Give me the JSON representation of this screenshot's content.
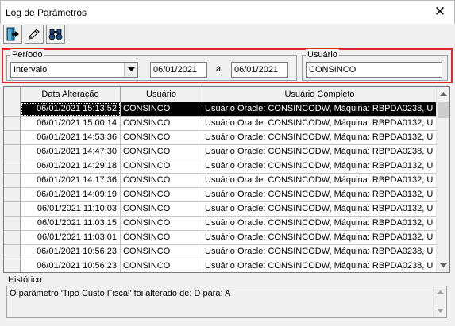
{
  "window": {
    "title": "Log de Parâmetros",
    "close_label": "✕"
  },
  "toolbar": {
    "buttons": [
      {
        "name": "exit-button",
        "icon": "exit-door-icon"
      },
      {
        "name": "edit-button",
        "icon": "pencil-icon"
      },
      {
        "name": "search-button",
        "icon": "binoculars-icon"
      }
    ]
  },
  "filters": {
    "periodo_label": "Período",
    "periodo_value": "Intervalo",
    "date_from": "06/01/2021",
    "separator": "à",
    "date_to": "06/01/2021",
    "usuario_label": "Usuário",
    "usuario_value": "CONSINCO",
    "highlight_color": "#e0252b"
  },
  "grid": {
    "columns": [
      "Data Alteração",
      "Usuário",
      "Usuário Completo"
    ],
    "rows": [
      {
        "date": "06/01/2021 15:13:52",
        "user": "CONSINCO",
        "full": "Usuário Oracle: CONSINCODW, Máquina: RBPDA0238, U",
        "selected": true
      },
      {
        "date": "06/01/2021 15:00:14",
        "user": "CONSINCO",
        "full": "Usuário Oracle: CONSINCODW, Máquina: RBPDA0132, U"
      },
      {
        "date": "06/01/2021 14:53:36",
        "user": "CONSINCO",
        "full": "Usuário Oracle: CONSINCODW, Máquina: RBPDA0132, U"
      },
      {
        "date": "06/01/2021 14:47:30",
        "user": "CONSINCO",
        "full": "Usuário Oracle: CONSINCODW, Máquina: RBPDA0238, U"
      },
      {
        "date": "06/01/2021 14:29:18",
        "user": "CONSINCO",
        "full": "Usuário Oracle: CONSINCODW, Máquina: RBPDA0132, U"
      },
      {
        "date": "06/01/2021 14:17:36",
        "user": "CONSINCO",
        "full": "Usuário Oracle: CONSINCODW, Máquina: RBPDA0132, U"
      },
      {
        "date": "06/01/2021 14:09:19",
        "user": "CONSINCO",
        "full": "Usuário Oracle: CONSINCODW, Máquina: RBPDA0132, U"
      },
      {
        "date": "06/01/2021 11:10:03",
        "user": "CONSINCO",
        "full": "Usuário Oracle: CONSINCODW, Máquina: RBPDA0132, U"
      },
      {
        "date": "06/01/2021 11:03:15",
        "user": "CONSINCO",
        "full": "Usuário Oracle: CONSINCODW, Máquina: RBPDA0132, U"
      },
      {
        "date": "06/01/2021 11:03:01",
        "user": "CONSINCO",
        "full": "Usuário Oracle: CONSINCODW, Máquina: RBPDA0132, U"
      },
      {
        "date": "06/01/2021 10:56:23",
        "user": "CONSINCO",
        "full": "Usuário Oracle: CONSINCODW, Máquina: RBPDA0238, U"
      },
      {
        "date": "06/01/2021 10:56:23",
        "user": "CONSINCO",
        "full": "Usuário Oracle: CONSINCODW, Máquina: RBPDA0238, U"
      }
    ]
  },
  "history": {
    "label": "Histórico",
    "text": "O parâmetro 'Tipo Custo Fiscal' foi alterado de: D para: A"
  }
}
